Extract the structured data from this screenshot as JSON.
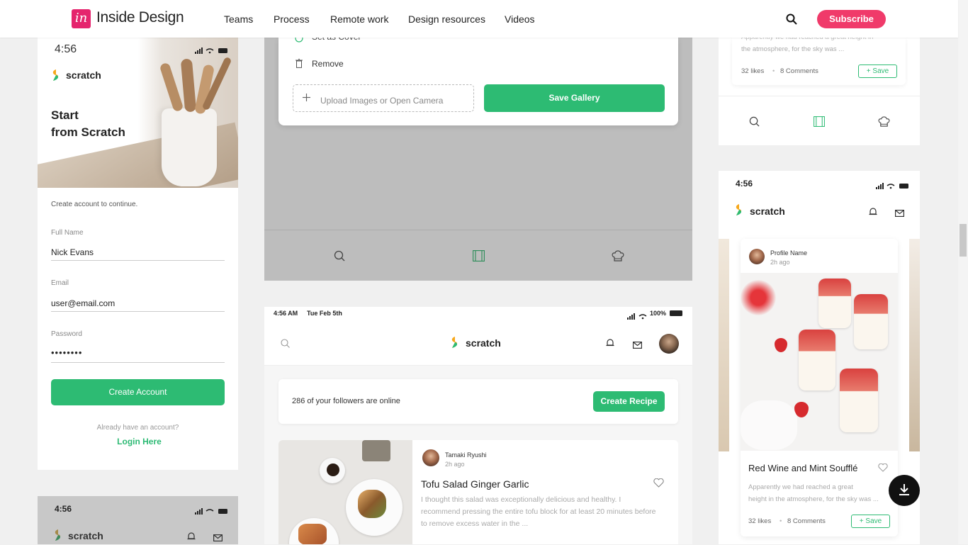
{
  "header": {
    "logo_mark": "in",
    "logo_text": "Inside Design",
    "nav": [
      "Teams",
      "Process",
      "Remote work",
      "Design resources",
      "Videos"
    ],
    "subscribe": "Subscribe"
  },
  "signup": {
    "time": "4:56",
    "brand": "scratch",
    "hero_line1": "Start",
    "hero_line2": "from Scratch",
    "intro": "Create account to continue.",
    "full_name_label": "Full Name",
    "full_name_value": "Nick Evans",
    "email_label": "Email",
    "email_value": "user@email.com",
    "password_label": "Password",
    "password_value": "••••••••",
    "create_button": "Create Account",
    "have_account": "Already have an account?",
    "login": "Login Here"
  },
  "signup2": {
    "time": "4:56",
    "brand": "scratch"
  },
  "gallery": {
    "set_cover": "Set as Cover",
    "remove": "Remove",
    "upload": "Upload Images or Open Camera",
    "save": "Save Gallery"
  },
  "tablet": {
    "time": "4:56 AM",
    "date": "Tue Feb 5th",
    "battery": "100%",
    "brand": "scratch",
    "followers": "286 of your followers are online",
    "create_recipe": "Create Recipe",
    "post": {
      "author": "Tamaki Ryushi",
      "ago": "2h ago",
      "title": "Tofu Salad Ginger Garlic",
      "body": "I thought this salad was exceptionally delicious and healthy. I recommend pressing the entire tofu block for at least 20 minutes before to remove excess water in the ..."
    }
  },
  "right_top": {
    "excerpt_line1": "Apparently we had reached a great height in",
    "excerpt_line2": "the atmosphere, for the sky was ...",
    "likes": "32 likes",
    "comments": "8 Comments",
    "save": "Save"
  },
  "right_phone": {
    "time": "4:56",
    "brand": "scratch",
    "profile_name": "Profile Name",
    "ago": "2h ago",
    "title": "Red Wine and Mint Soufflé",
    "excerpt_line1": "Apparently we had reached a great",
    "excerpt_line2": "height in the atmosphere, for the sky was ...",
    "likes": "32 likes",
    "comments": "8 Comments",
    "save": "Save"
  },
  "colors": {
    "accent": "#2dbb73",
    "brand_pink": "#e5246d",
    "subscribe": "#f03a6a"
  },
  "icons": [
    "search-icon",
    "gallery-icon",
    "chef-hat-icon",
    "bell-icon",
    "mail-icon",
    "heart-icon",
    "download-icon",
    "trash-icon",
    "plus-icon"
  ]
}
